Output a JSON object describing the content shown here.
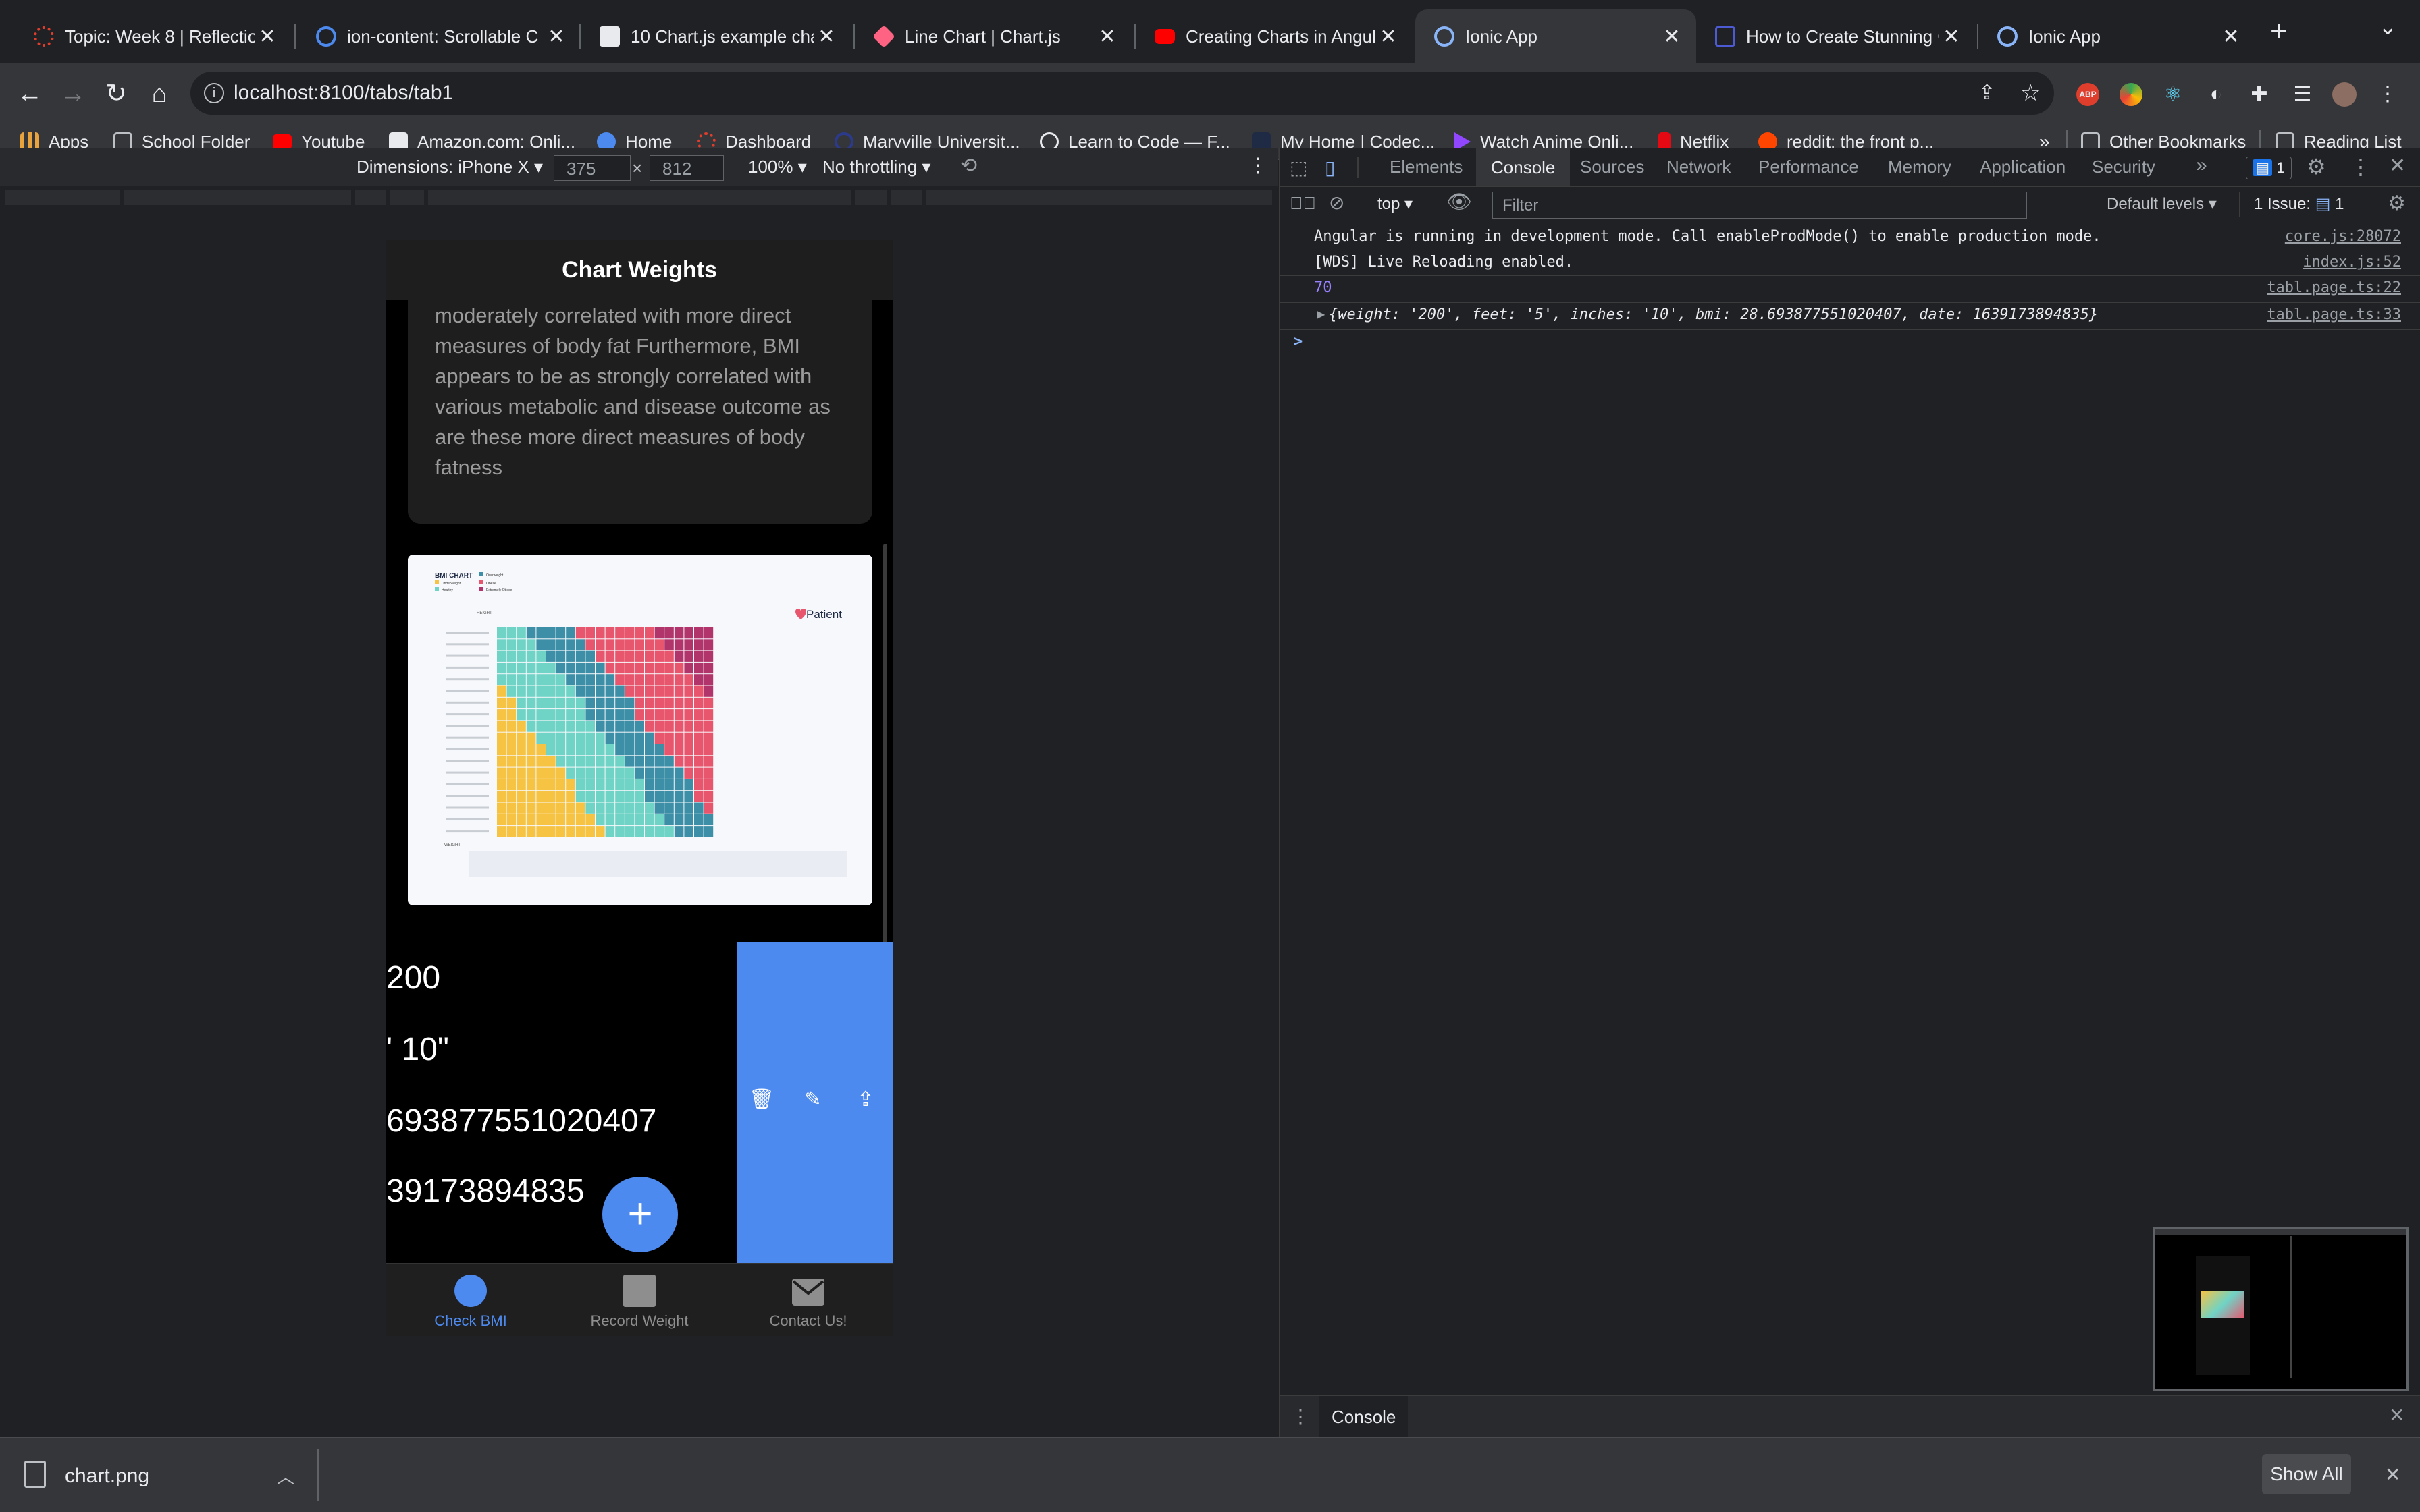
{
  "browser": {
    "tabs": [
      {
        "title": "Topic: Week 8 | Reflectio",
        "icon": "canvas-icon",
        "color": "#e03e2d"
      },
      {
        "title": "ion-content: Scrollable C",
        "icon": "ionic-icon",
        "color": "#4d8af0"
      },
      {
        "title": "10 Chart.js example chart",
        "icon": "chartjs-blog-icon",
        "color": "#e8eaed"
      },
      {
        "title": "Line Chart | Chart.js",
        "icon": "chartjs-icon",
        "color": "#ff6384"
      },
      {
        "title": "Creating Charts in Angula",
        "icon": "youtube-icon",
        "color": "#ff0000"
      },
      {
        "title": "Ionic App",
        "icon": "ionic-icon",
        "color": "#4d8af0",
        "active": true
      },
      {
        "title": "How to Create Stunning C",
        "icon": "video-icon",
        "color": "#4c5bd4"
      },
      {
        "title": "Ionic App",
        "icon": "ionic-icon",
        "color": "#4d8af0"
      }
    ],
    "new_tab": "+",
    "tab_menu": "⌄",
    "url": "localhost:8100/tabs/tab1",
    "bookmarks": [
      {
        "label": "Apps",
        "icon": "apps-grid-icon",
        "color": "#e8a33d"
      },
      {
        "label": "School Folder",
        "icon": "folder-icon",
        "color": "#bdc1c6"
      },
      {
        "label": "Youtube",
        "icon": "youtube-icon",
        "color": "#ff0000"
      },
      {
        "label": "Amazon.com: Onli...",
        "icon": "amazon-icon",
        "color": "#e8eaed"
      },
      {
        "label": "Home",
        "icon": "cloud-icon",
        "color": "#4d8af0"
      },
      {
        "label": "Dashboard",
        "icon": "dashboard-icon",
        "color": "#e03e2d"
      },
      {
        "label": "Maryville Universit...",
        "icon": "maryville-icon",
        "color": "#2b3a8c"
      },
      {
        "label": "Learn to Code — F...",
        "icon": "freecodecamp-icon",
        "color": "#e8eaed"
      },
      {
        "label": "My Home | Codec...",
        "icon": "codecademy-icon",
        "color": "#1f2a44"
      },
      {
        "label": "Watch Anime Onli...",
        "icon": "anime-icon",
        "color": "#9146ff"
      },
      {
        "label": "Netflix",
        "icon": "netflix-icon",
        "color": "#e50914"
      },
      {
        "label": "reddit: the front p...",
        "icon": "reddit-icon",
        "color": "#ff4500"
      }
    ],
    "bookmarks_more": "»",
    "other_bookmarks": "Other Bookmarks",
    "reading_list": "Reading List"
  },
  "device_toolbar": {
    "dimensions": "Dimensions: iPhone X",
    "width": "375",
    "times": "×",
    "height": "812",
    "zoom": "100%",
    "throttling": "No throttling"
  },
  "app": {
    "header_title": "Chart Weights",
    "paragraph": "measure body fat directly, but BMI is moderately correlated with more direct measures of body fat Furthermore, BMI appears to be as strongly correlated with various metabolic and disease outcome as are these more direct measures of body fatness",
    "bmi_chart": {
      "title": "BMI CHART",
      "legend": [
        "Underweight",
        "Healthy",
        "Overweight",
        "Obese",
        "Extremely Obese"
      ],
      "brand": "Patient",
      "height_label": "HEIGHT",
      "weight_label": "WEIGHT",
      "colors": {
        "underweight": "#f7c343",
        "healthy": "#6fd3c6",
        "overweight": "#3d8fa8",
        "obese": "#e8566e",
        "extreme": "#b1346a"
      }
    },
    "values": [
      "200",
      "' 10\"",
      "693877551020407",
      "39173894835"
    ],
    "fab": "+",
    "tabs": [
      {
        "label": "Check BMI",
        "icon": "circle-icon",
        "active": true
      },
      {
        "label": "Record Weight",
        "icon": "square-icon"
      },
      {
        "label": "Contact Us!",
        "icon": "mail-icon"
      }
    ]
  },
  "devtools": {
    "tabs": [
      "Elements",
      "Console",
      "Sources",
      "Network",
      "Performance",
      "Memory",
      "Application",
      "Security"
    ],
    "active_tab": "Console",
    "more": "»",
    "badge_count": "1",
    "context": "top",
    "filter_placeholder": "Filter",
    "levels": "Default levels",
    "issues": "1 Issue:",
    "issues_count": "1",
    "console": [
      {
        "text": "Angular is running in development mode. Call enableProdMode() to enable production mode.",
        "source": "core.js:28072"
      },
      {
        "text": "[WDS] Live Reloading enabled.",
        "source": "index.js:52"
      },
      {
        "text": "70",
        "source": "tabl.page.ts:22"
      },
      {
        "text": "{weight: '200', feet: '5', inches: '10', bmi: 28.693877551020407, date: 1639173894835}",
        "source": "tabl.page.ts:33"
      }
    ],
    "prompt": ">",
    "drawer_tab": "Console"
  },
  "download": {
    "file": "chart.png",
    "show_all": "Show All"
  }
}
